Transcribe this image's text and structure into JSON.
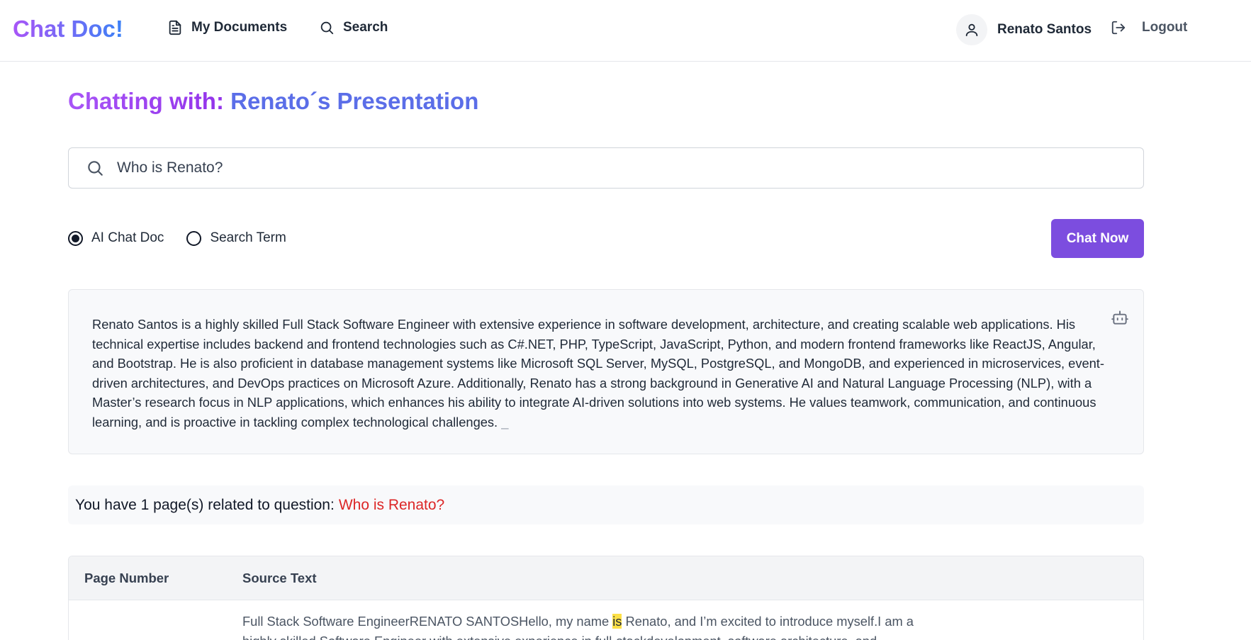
{
  "navbar": {
    "brand": "Chat Doc!",
    "links": [
      {
        "label": "My Documents",
        "icon": "document-icon"
      },
      {
        "label": "Search",
        "icon": "search-icon"
      }
    ],
    "user_name": "Renato Santos",
    "logout_label": "Logout"
  },
  "page": {
    "title_lead": "Chatting with:",
    "title_doc": "Renato´s Presentation"
  },
  "search": {
    "value": "Who is Renato?"
  },
  "mode": {
    "options": [
      {
        "label": "AI Chat Doc",
        "selected": true
      },
      {
        "label": "Search Term",
        "selected": false
      }
    ],
    "button_label": "Chat Now"
  },
  "answer": {
    "text": "Renato Santos is a highly skilled Full Stack Software Engineer with extensive experience in software development, architecture, and creating scalable web applications. His technical expertise includes backend and frontend technologies such as C#.NET, PHP, TypeScript, JavaScript, Python, and modern frontend frameworks like ReactJS, Angular, and Bootstrap. He is also proficient in database management systems like Microsoft SQL Server, MySQL, PostgreSQL, and MongoDB, and experienced in microservices, event-driven architectures, and DevOps practices on Microsoft Azure. Additionally, Renato has a strong background in Generative AI and Natural Language Processing (NLP), with a Master’s research focus in NLP applications, which enhances his ability to integrate AI-driven solutions into web systems. He values teamwork, communication, and continuous learning, and is proactive in tackling complex technological challenges.",
    "cursor": "_"
  },
  "related": {
    "prefix": "You have 1 page(s) related to question:",
    "question": "Who is Renato?"
  },
  "table": {
    "headers": [
      "Page Number",
      "Source Text"
    ],
    "rows": [
      {
        "page": "",
        "source_before": "Full Stack Software EngineerRENATO SANTOSHello, my name ",
        "highlight": "is",
        "source_after": " Renato, and I’m excited to introduce myself.I am a highly skilled Software Engineer with extensive experience in full-stackdevelopment, software architecture, and"
      }
    ]
  },
  "colors": {
    "brand_start": "#a855f7",
    "brand_end": "#3b82f6",
    "primary_button": "#7c4ddf",
    "question_highlight": "#dc2626",
    "term_highlight": "#fde047"
  }
}
